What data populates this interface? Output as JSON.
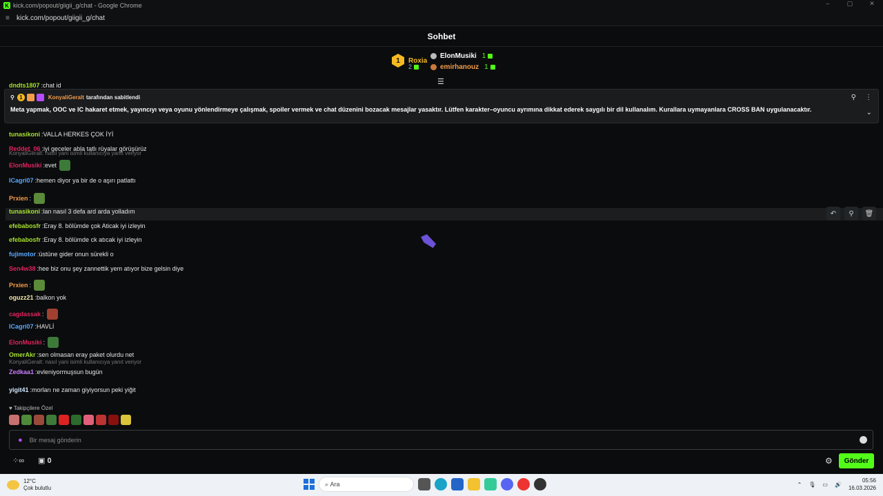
{
  "window": {
    "title": "kick.com/popout/giigii_g/chat - Google Chrome",
    "url": "kick.com/popout/giigii_g/chat",
    "controls": [
      "–",
      "▢",
      "✕"
    ]
  },
  "header": {
    "title": "Sohbet"
  },
  "leaderboard": {
    "first": {
      "rank": "1",
      "name": "Roxia",
      "count": "2"
    },
    "second": {
      "name": "ElonMusiki",
      "count": "1"
    },
    "third": {
      "name": "emirhanouz",
      "count": "1"
    }
  },
  "pinned": {
    "pinned_by": "KonyaliGeralt",
    "suffix": "tarafından sabitlendi",
    "message": "Meta yapmak, OOC ve IC hakaret etmek, yayıncıyı veya oyunu yönlendirmeye çalışmak, spoiler vermek ve chat düzenini bozacak mesajlar yasaktır. Lütfen karakter–oyuncu ayrımına dikkat ederek saygılı bir dil kullanalım. Kurallara uymayanlara CROSS BAN uygulanacaktır."
  },
  "partial_top": {
    "user": "dndts1807",
    "text": "chat id"
  },
  "messages": [
    {
      "user": "tunasikoni",
      "color": "#a6e22e",
      "text": "VALLA HERKES ÇOK İYİ"
    },
    {
      "user": "Reddet_06",
      "color": "#e0245e",
      "text": "iyi geceler abla tatlı rüyalar görüşürüz"
    },
    {
      "reply": "KonyaliGeralt: nasıl yani isimli kullanıcıya yanıt veriyor",
      "user": "ElonMusiki",
      "color": "#e0245e",
      "text": "evet"
    },
    {
      "user": "ICagri07",
      "color": "#5aa9ff",
      "text": "hemen diyor ya bir de o aşırı patlattı"
    },
    {
      "user": "Prxien",
      "color": "#f39c4a",
      "text": ""
    },
    {
      "user": "tunasikoni",
      "color": "#a6e22e",
      "text": "lan nasıl 3 defa ard arda yolladım"
    },
    {
      "user": "efebabosfr",
      "color": "#a6e22e",
      "text": "Eray 8. bölümde çok Aticak iyi izleyin"
    },
    {
      "user": "efebabosfr",
      "color": "#a6e22e",
      "text": "Eray 8. bölümde ck atıcak iyi izleyin"
    },
    {
      "user": "fujimotor",
      "color": "#5aa9ff",
      "text": "üstüne gider onun sürekli o"
    },
    {
      "user": "Sen4w38",
      "color": "#e0245e",
      "text": "hee biz onu şey zannettik yem atıyor bize gelsin diye"
    },
    {
      "user": "Prxien",
      "color": "#f39c4a",
      "text": ""
    },
    {
      "user": "oguzz21",
      "color": "#f5e6a8",
      "text": "balkon yok"
    },
    {
      "user": "cagdassak",
      "color": "#e0245e",
      "text": ""
    },
    {
      "user": "ICagri07",
      "color": "#5aa9ff",
      "text": "HAVLİ"
    },
    {
      "user": "ElonMusiki",
      "color": "#e0245e",
      "text": ""
    },
    {
      "user": "OmerAkr",
      "color": "#a6e22e",
      "text": "sen olmasan eray paket olurdu net"
    },
    {
      "reply": "KonyaliGeralt: nasıl yani isimli kullanıcıya yanıt veriyor",
      "user": "Zedkaa1",
      "color": "#c77dff",
      "text": "evleniyormuşsun bugün"
    },
    {
      "user": "yigit41",
      "color": "#cfe7ff",
      "text": "morları ne zaman giyiyorsun peki yiğit"
    }
  ],
  "emote_section": {
    "label": "Takipçilere Özel"
  },
  "input": {
    "placeholder": "Bir mesaj gönderin"
  },
  "bottom": {
    "count": "0",
    "send_label": "Gönder"
  },
  "taskbar": {
    "temp": "12°C",
    "weather": "Çok bulutlu",
    "search": "Ara",
    "time": "05:56",
    "date": "16.03.2026"
  }
}
